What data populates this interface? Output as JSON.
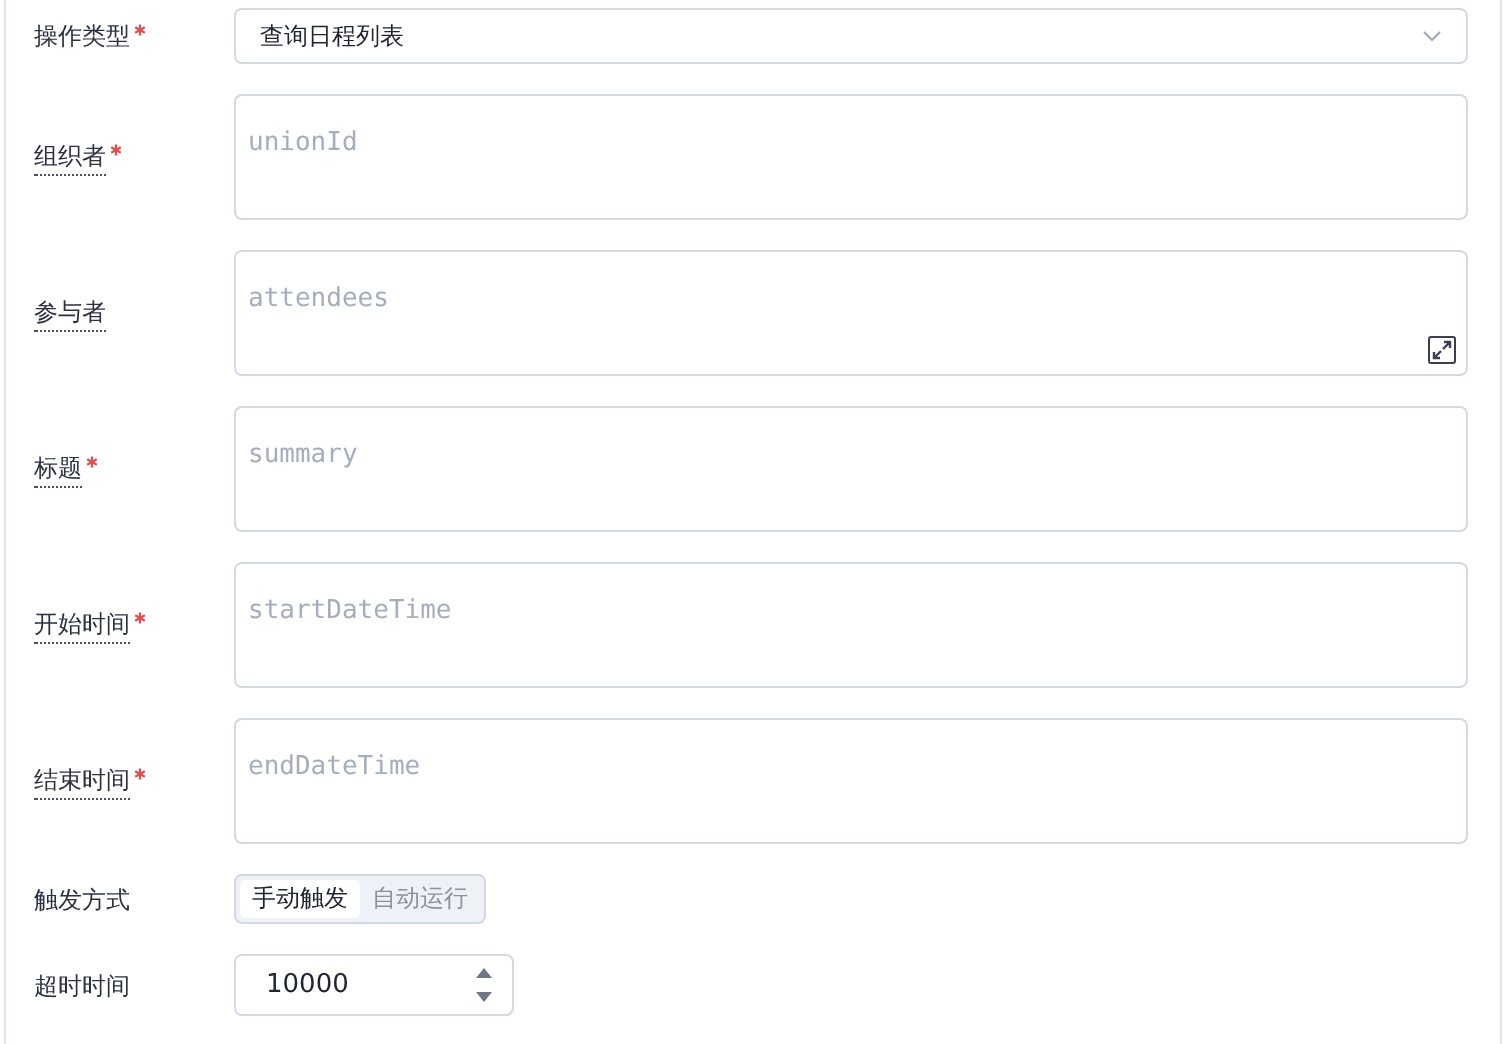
{
  "fields": [
    {
      "kind": "select",
      "label": "操作类型",
      "required": true,
      "hinted": false,
      "value": "查询日程列表"
    },
    {
      "kind": "textarea",
      "label": "组织者",
      "required": true,
      "hinted": true,
      "placeholder": "unionId",
      "expandable": false
    },
    {
      "kind": "textarea",
      "label": "参与者",
      "required": false,
      "hinted": true,
      "placeholder": "attendees",
      "expandable": true
    },
    {
      "kind": "textarea",
      "label": "标题",
      "required": true,
      "hinted": true,
      "placeholder": "summary",
      "expandable": false
    },
    {
      "kind": "textarea",
      "label": "开始时间",
      "required": true,
      "hinted": true,
      "placeholder": "startDateTime",
      "expandable": false
    },
    {
      "kind": "textarea",
      "label": "结束时间",
      "required": true,
      "hinted": true,
      "placeholder": "endDateTime",
      "expandable": false
    },
    {
      "kind": "segmented",
      "label": "触发方式",
      "required": false,
      "hinted": false,
      "options": [
        {
          "label": "手动触发",
          "selected": true
        },
        {
          "label": "自动运行",
          "selected": false
        }
      ]
    },
    {
      "kind": "number",
      "label": "超时时间",
      "required": false,
      "hinted": false,
      "value": "10000"
    }
  ]
}
